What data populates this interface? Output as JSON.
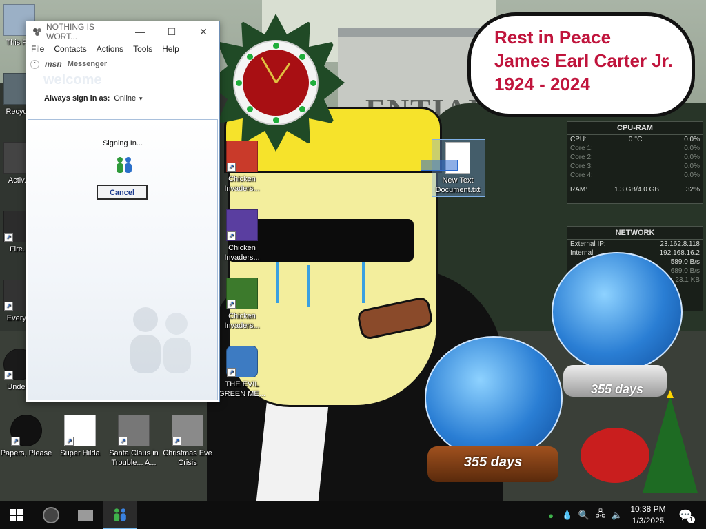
{
  "wallpaper": {
    "building_text": "ENTIAL",
    "bubble_lines": [
      "Rest in Peace",
      "James Earl Carter Jr.",
      "1924 - 2024"
    ]
  },
  "msn": {
    "window_title": "NOTHING IS WORT...",
    "menu": [
      "File",
      "Contacts",
      "Actions",
      "Tools",
      "Help"
    ],
    "brand_msn": "msn",
    "brand_messenger": "Messenger",
    "welcome": "welcome",
    "sign_in_as_label": "Always sign in as:",
    "sign_in_as_value": "Online",
    "status_text": "Signing In...",
    "cancel_label": "Cancel"
  },
  "desktop_icons": [
    {
      "label": "This PC",
      "color": "#9bb0c6"
    },
    {
      "label": "Recycle",
      "color": "#5b6a72"
    },
    {
      "label": "Activ...",
      "color": "#444"
    },
    {
      "label": "Fire...",
      "color": "#2c2c2c"
    },
    {
      "label": "Every...",
      "color": "#333"
    },
    {
      "label": "Unde...",
      "color": "#1a1a1a"
    },
    {
      "label": "Papers, Please",
      "color": "#111"
    },
    {
      "label": "Super Hilda",
      "color": "#ffffff"
    },
    {
      "label": "Santa Claus in Trouble... A...",
      "color": "#777"
    },
    {
      "label": "Christmas Eve Crisis",
      "color": "#8a8a8a"
    },
    {
      "label": "Chicken Invaders...",
      "color": "#c93a2a"
    },
    {
      "label": "Chicken Invaders...",
      "color": "#5a3ea0"
    },
    {
      "label": "Chicken Invaders...",
      "color": "#3c7a2c"
    },
    {
      "label": "THE EVIL GREEN ME...",
      "color": "#3d7bc2"
    },
    {
      "label": "New Text Document.txt",
      "color": "#ffffff"
    }
  ],
  "cpu_gadget": {
    "title": "CPU-RAM",
    "cpu_label": "CPU:",
    "cpu_temp": "0 °C",
    "cpu_value": "0.0%",
    "cores": [
      {
        "label": "Core 1:",
        "value": "0.0%"
      },
      {
        "label": "Core 2:",
        "value": "0.0%"
      },
      {
        "label": "Core 3:",
        "value": "0.0%"
      },
      {
        "label": "Core 4:",
        "value": "0.0%"
      }
    ],
    "ram_label": "RAM:",
    "ram_used": "1.3 GB/4.0 GB",
    "ram_pct": "32%"
  },
  "net_gadget": {
    "title": "NETWORK",
    "external_label": "External IP:",
    "external_ip": "23.162.8.118",
    "internal_label": "Internal",
    "internal_ip": "192.168.16.2",
    "up": "589.0 B/s",
    "down": "689.0 B/s",
    "total": "23.1 KB"
  },
  "globes": {
    "left_days": "355 days",
    "right_days": "355 days"
  },
  "taskbar": {
    "time": "10:38 PM",
    "date": "1/3/2025",
    "notification_count": "1"
  }
}
